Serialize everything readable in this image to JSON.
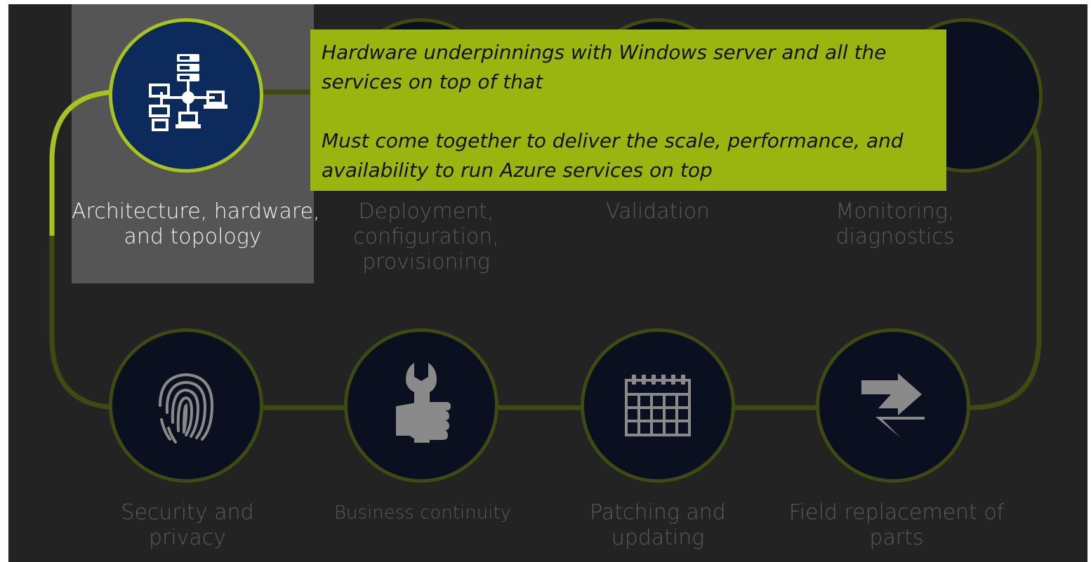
{
  "colors": {
    "background": "#232323",
    "highlight": "#555555",
    "accent_lime": "#a6c41c",
    "dim_ring": "#3e4a12",
    "callout": "#9bb510",
    "node_active": "#0d2a5c",
    "node_dim": "#0a1020"
  },
  "callout": {
    "line1": "Hardware underpinnings with Windows server and all the",
    "line2": "services on top of that",
    "line3": "Must come together to deliver the scale, performance, and",
    "line4": "availability to run Azure services on top"
  },
  "top_row": [
    {
      "lines": [
        "Architecture, hardware,",
        "and topology"
      ],
      "icon": "server-network-icon",
      "active": true
    },
    {
      "lines": [
        "Deployment,",
        "configuration,",
        "provisioning"
      ],
      "icon": "deployment-icon",
      "active": false
    },
    {
      "lines": [
        "Validation"
      ],
      "icon": "validation-icon",
      "active": false
    },
    {
      "lines": [
        "Monitoring,",
        "diagnostics"
      ],
      "icon": "monitoring-icon",
      "active": false
    }
  ],
  "bottom_row": [
    {
      "lines": [
        "Security and",
        "privacy"
      ],
      "icon": "fingerprint-icon"
    },
    {
      "lines": [
        "Business continuity"
      ],
      "icon": "wrench-hand-icon"
    },
    {
      "lines": [
        "Patching and",
        "updating"
      ],
      "icon": "calendar-icon"
    },
    {
      "lines": [
        "Field replacement of",
        "parts"
      ],
      "icon": "swap-arrows-icon"
    }
  ]
}
